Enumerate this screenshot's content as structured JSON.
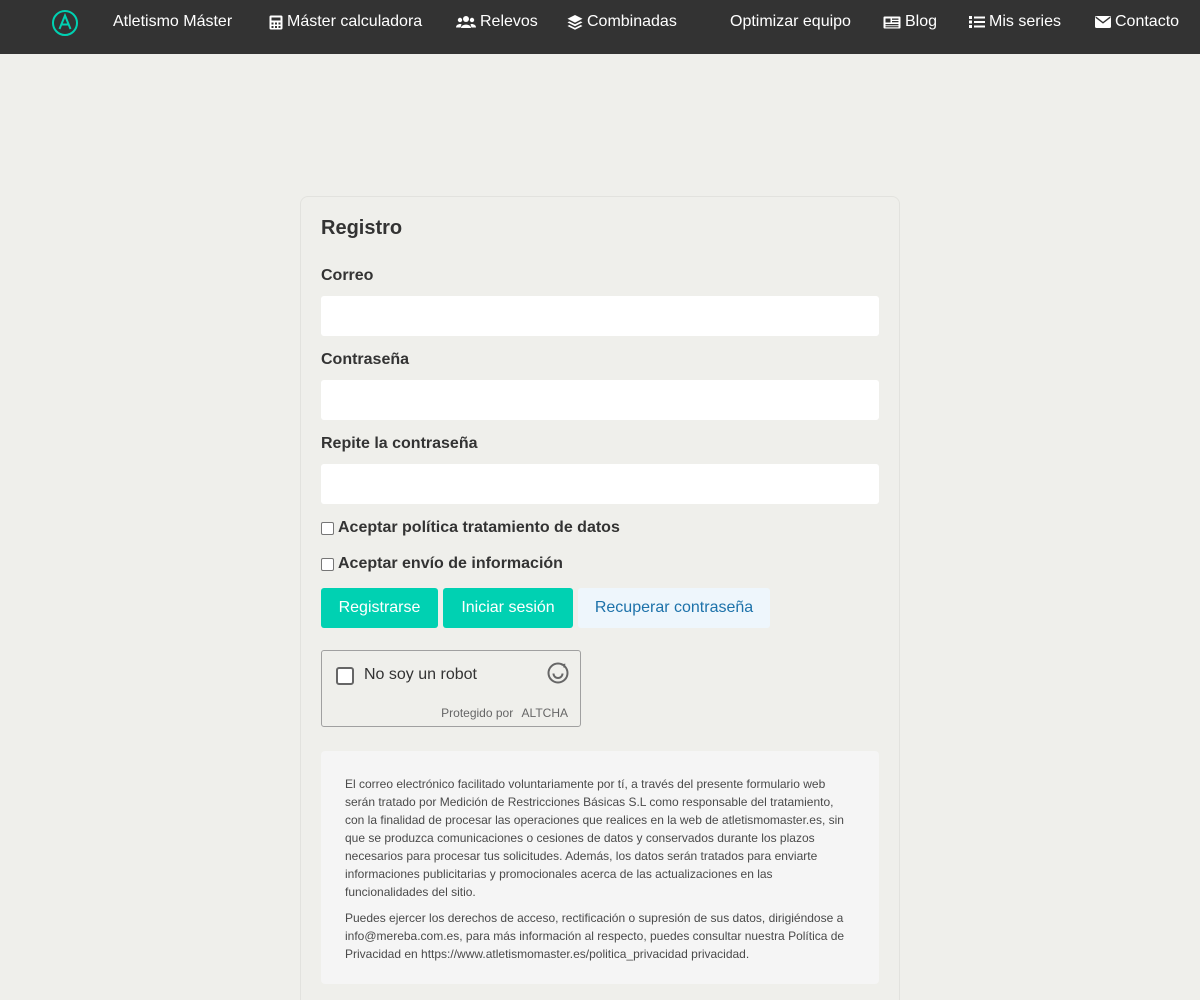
{
  "nav": {
    "brand": "Atletismo Máster",
    "items": [
      {
        "label": "Máster calculadora",
        "icon": "calculator-icon"
      },
      {
        "label": "Relevos",
        "icon": "users-icon"
      },
      {
        "label": "Combinadas",
        "icon": "layers-icon"
      },
      {
        "label": "Optimizar equipo",
        "icon": ""
      },
      {
        "label": "Blog",
        "icon": "newspaper-icon"
      },
      {
        "label": "Mis series",
        "icon": "list-icon"
      },
      {
        "label": "Contacto",
        "icon": "envelope-icon"
      }
    ]
  },
  "form": {
    "title": "Registro",
    "email_label": "Correo",
    "email_value": "",
    "password_label": "Contraseña",
    "password_value": "",
    "repeat_password_label": "Repite la contraseña",
    "repeat_password_value": "",
    "privacy_checkbox": "Aceptar política tratamiento de datos",
    "info_checkbox": "Aceptar envío de información",
    "register_button": "Registrarse",
    "login_button": "Iniciar sesión",
    "recover_button": "Recuperar contraseña"
  },
  "captcha": {
    "label": "No soy un robot",
    "protected_by": "Protegido por",
    "provider": "ALTCHA"
  },
  "notice": {
    "paragraph1": "El correo electrónico facilitado voluntariamente por tí, a través del presente formulario web serán tratado por Medición de Restricciones Básicas S.L como responsable del tratamiento, con la finalidad de procesar las operaciones que realices en la web de atletismomaster.es, sin que se produzca comunicaciones o cesiones de datos y conservados durante los plazos necesarios para procesar tus solicitudes. Además, los datos serán tratados para enviarte informaciones publicitarias y promocionales acerca de las actualizaciones en las funcionalidades del sitio.",
    "paragraph2": "Puedes ejercer los derechos de acceso, rectificación o supresión de sus datos, dirigiéndose a info@mereba.com.es, para más información al respecto, puedes consultar nuestra Política de Privacidad en https://www.atletismomaster.es/politica_privacidad privacidad."
  },
  "colors": {
    "navbar": "#333333",
    "accent": "#00d1b2",
    "link": "#1d72aa",
    "background": "#efefeb"
  }
}
